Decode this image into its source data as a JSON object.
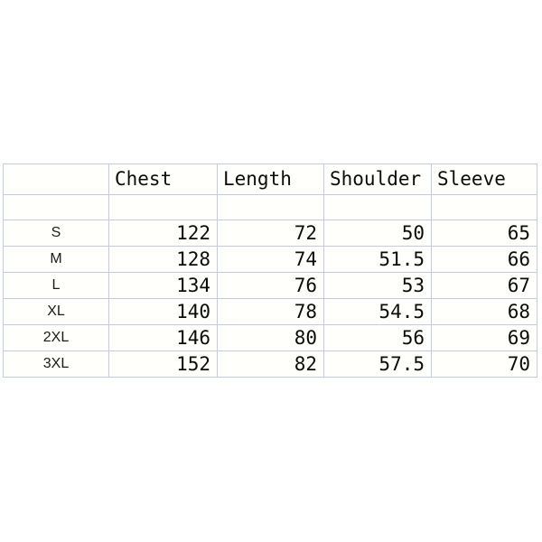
{
  "table": {
    "corner_label": "",
    "columns": [
      "Chest",
      "Length",
      "Shoulder",
      "Sleeve"
    ],
    "size_column_header": "",
    "spacer_row": {
      "size": "",
      "values": [
        "",
        "",
        "",
        ""
      ]
    },
    "rows": [
      {
        "size": "S",
        "chest": "122",
        "length": "72",
        "shoulder": "50",
        "sleeve": "65"
      },
      {
        "size": "M",
        "chest": "128",
        "length": "74",
        "shoulder": "51.5",
        "sleeve": "66"
      },
      {
        "size": "L",
        "chest": "134",
        "length": "76",
        "shoulder": "53",
        "sleeve": "67"
      },
      {
        "size": "XL",
        "chest": "140",
        "length": "78",
        "shoulder": "54.5",
        "sleeve": "68"
      },
      {
        "size": "2XL",
        "chest": "146",
        "length": "80",
        "shoulder": "56",
        "sleeve": "69"
      },
      {
        "size": "3XL",
        "chest": "152",
        "length": "82",
        "shoulder": "57.5",
        "sleeve": "70"
      }
    ]
  },
  "colors": {
    "grid_line": "#c3cbe1",
    "page_background": "#ffffff",
    "cell_tint": "#fffffa",
    "text": "#0b0b0b"
  }
}
